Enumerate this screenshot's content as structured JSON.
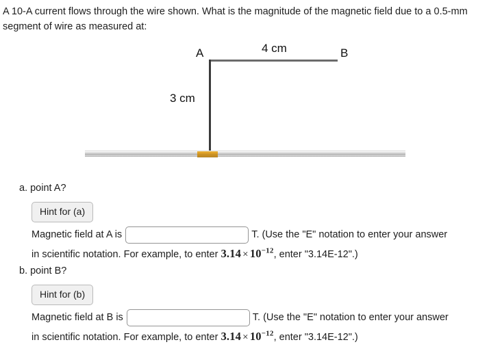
{
  "question": {
    "line1": "A 10-A current flows through the wire shown. What is the magnitude of the magnetic field due to a",
    "line2": "0.5-mm segment of wire as measured at:"
  },
  "figure": {
    "label_a": "A",
    "label_b": "B",
    "horizontal_length": "4 cm",
    "vertical_length": "3 cm",
    "colors": {
      "bar": "#c6c6c6",
      "segment": "#d79b27",
      "wire": "#3b3b3b"
    }
  },
  "parts": [
    {
      "heading": "a. point A?",
      "hint_label": "Hint for (a)",
      "answer_prefix": "Magnetic field at A is",
      "input_value": "",
      "input_placeholder": "",
      "answer_suffix": "T. (Use the \"E\" notation to enter your answer",
      "answer_line2_before": "in scientific notation. For example, to enter",
      "math_mantissa": "3.14",
      "math_times": "×",
      "math_base": "10",
      "math_exponent": "−12",
      "answer_line2_after": ", enter \"3.14E-12\".)"
    },
    {
      "heading": "b. point B?",
      "hint_label": "Hint for (b)",
      "answer_prefix": "Magnetic field at B is",
      "input_value": "",
      "input_placeholder": "",
      "answer_suffix": "T. (Use the \"E\" notation to enter your answer",
      "answer_line2_before": "in scientific notation. For example, to enter",
      "math_mantissa": "3.14",
      "math_times": "×",
      "math_base": "10",
      "math_exponent": "−12",
      "answer_line2_after": ", enter \"3.14E-12\".)"
    }
  ]
}
